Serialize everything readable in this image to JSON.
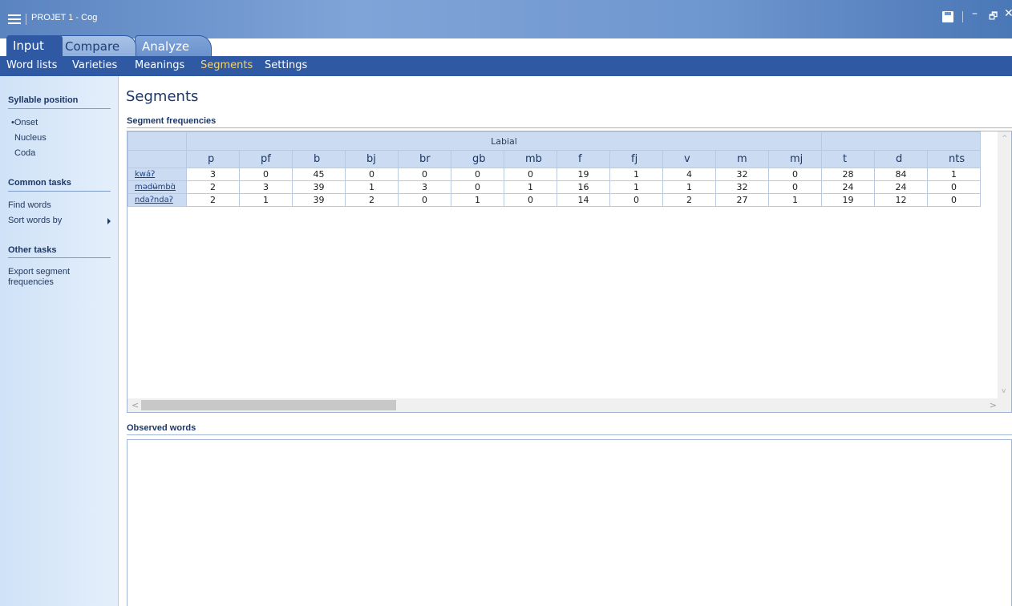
{
  "window": {
    "title": "PROJET 1 - Cog",
    "icons": [
      "menu-icon",
      "save-icon",
      "minimize-icon",
      "restore-icon",
      "close-icon"
    ],
    "minimize": "–",
    "restore": "🗗",
    "close": "✕"
  },
  "tabs": [
    {
      "label": "Input"
    },
    {
      "label": "Compare"
    },
    {
      "label": "Analyze"
    }
  ],
  "subnav": [
    {
      "label": "Word lists"
    },
    {
      "label": "Varieties"
    },
    {
      "label": "Meanings"
    },
    {
      "label": "Segments",
      "active": true
    },
    {
      "label": "Settings"
    }
  ],
  "sidebar": {
    "syllable_heading": "Syllable position",
    "positions": [
      {
        "label": "Onset",
        "selected": true
      },
      {
        "label": "Nucleus"
      },
      {
        "label": "Coda"
      }
    ],
    "bullet": "•",
    "common_heading": "Common tasks",
    "common_tasks": [
      {
        "label": "Find words"
      },
      {
        "label": "Sort words by"
      }
    ],
    "other_heading": "Other tasks",
    "other_tasks": [
      {
        "label": "Export segment frequencies"
      }
    ]
  },
  "main": {
    "title": "Segments",
    "frequencies_heading": "Segment frequencies",
    "observed_heading": "Observed words"
  },
  "grid": {
    "group_label": "Labial",
    "segments": [
      "p",
      "pf",
      "b",
      "bj",
      "br",
      "gb",
      "mb",
      "f",
      "fj",
      "v",
      "m",
      "mj",
      "t",
      "d",
      "nts"
    ],
    "rows": [
      {
        "variety": "kwáʔ",
        "values": [
          "3",
          "0",
          "45",
          "0",
          "0",
          "0",
          "0",
          "19",
          "1",
          "4",
          "32",
          "0",
          "28",
          "84",
          "1"
        ]
      },
      {
        "variety": "mədʉ̀mbɑ̀",
        "values": [
          "2",
          "3",
          "39",
          "1",
          "3",
          "0",
          "1",
          "16",
          "1",
          "1",
          "32",
          "0",
          "24",
          "24",
          "0"
        ]
      },
      {
        "variety": "ndaʔndaʔ",
        "values": [
          "2",
          "1",
          "39",
          "2",
          "0",
          "1",
          "0",
          "14",
          "0",
          "2",
          "27",
          "1",
          "19",
          "12",
          "0"
        ]
      }
    ]
  },
  "scroll": {
    "up": "^",
    "down": "v",
    "left": "<",
    "right": ">"
  },
  "colors": {
    "accent": "#2f5aa3",
    "active_subnav": "#f4d36b",
    "header_fill": "#cbdcf2"
  }
}
